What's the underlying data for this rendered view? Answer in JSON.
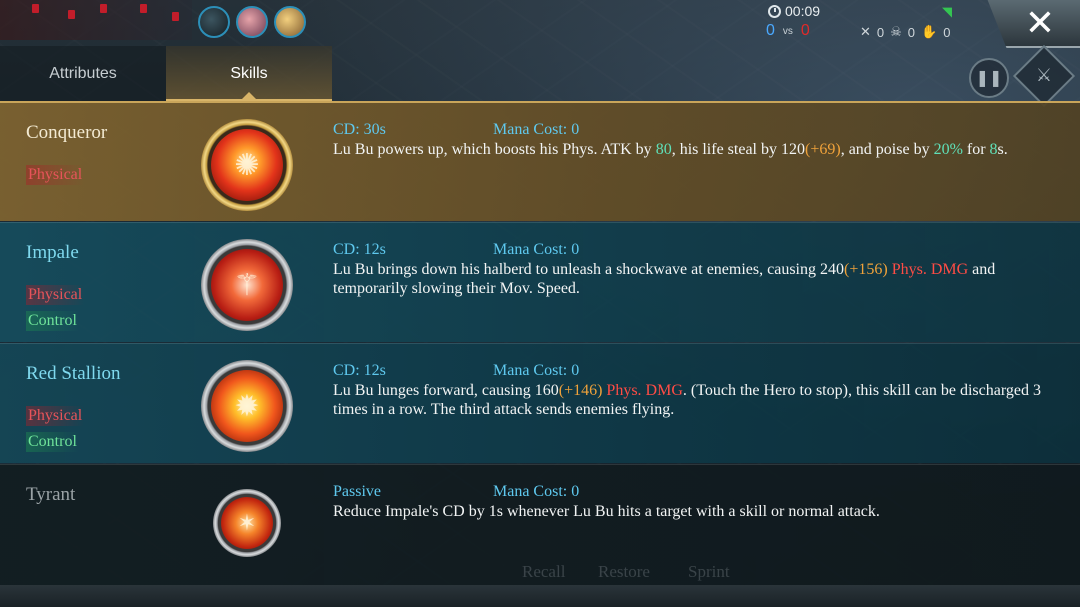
{
  "hud": {
    "timer": "00:09",
    "score_blue": "0",
    "score_vs": "vs",
    "score_red": "0",
    "kills": "0",
    "deaths": "0",
    "assists": "0"
  },
  "tabs": [
    {
      "label": "Attributes",
      "active": false
    },
    {
      "label": "Skills",
      "active": true
    }
  ],
  "skills": [
    {
      "name": "Conqueror",
      "tags": [
        "Physical"
      ],
      "cd": "CD: 30s",
      "mana": "Mana Cost: 0",
      "desc": [
        {
          "t": "Lu Bu powers up, which boosts his Phys. ATK by ",
          "c": ""
        },
        {
          "t": "80",
          "c": "g"
        },
        {
          "t": ", his life steal by 120",
          "c": ""
        },
        {
          "t": "(+69)",
          "c": "o"
        },
        {
          "t": ", and poise by ",
          "c": ""
        },
        {
          "t": "20%",
          "c": "g"
        },
        {
          "t": " for ",
          "c": ""
        },
        {
          "t": "8",
          "c": "g"
        },
        {
          "t": "s.",
          "c": ""
        }
      ],
      "icon": "sun-burst-icon"
    },
    {
      "name": "Impale",
      "tags": [
        "Physical",
        "Control"
      ],
      "cd": "CD: 12s",
      "mana": "Mana Cost: 0",
      "desc": [
        {
          "t": "Lu Bu brings down his halberd to unleash a shockwave at enemies, causing 240",
          "c": ""
        },
        {
          "t": "(+156)",
          "c": "o"
        },
        {
          "t": " ",
          "c": ""
        },
        {
          "t": "Phys. DMG",
          "c": "r"
        },
        {
          "t": " and temporarily slowing their Mov. Speed.",
          "c": ""
        }
      ],
      "icon": "halberd-icon"
    },
    {
      "name": "Red Stallion",
      "tags": [
        "Physical",
        "Control"
      ],
      "cd": "CD: 12s",
      "mana": "Mana Cost: 0",
      "desc": [
        {
          "t": "Lu Bu lunges forward, causing 160",
          "c": ""
        },
        {
          "t": "(+146)",
          "c": "o"
        },
        {
          "t": " ",
          "c": ""
        },
        {
          "t": "Phys. DMG",
          "c": "r"
        },
        {
          "t": ". (Touch the Hero to stop), this skill can be discharged 3 times in a row. The third attack sends enemies flying.",
          "c": ""
        }
      ],
      "icon": "fire-burst-icon"
    },
    {
      "name": "Tyrant",
      "tags": [],
      "cd": "Passive",
      "mana": "Mana Cost: 0",
      "desc": [
        {
          "t": "Reduce Impale's CD by 1s whenever Lu Bu hits a target with a skill or normal attack.",
          "c": ""
        }
      ],
      "icon": "blades-icon"
    }
  ],
  "ghost_buttons": [
    "Recall",
    "Restore",
    "Sprint"
  ],
  "colors": {
    "highlight_green": "#5fe0b8",
    "highlight_orange": "#f0a23a",
    "highlight_red": "#ff4c45",
    "meta_blue": "#5fc9ef",
    "tag_physical": "#e7545a",
    "tag_control": "#6fe39a"
  }
}
